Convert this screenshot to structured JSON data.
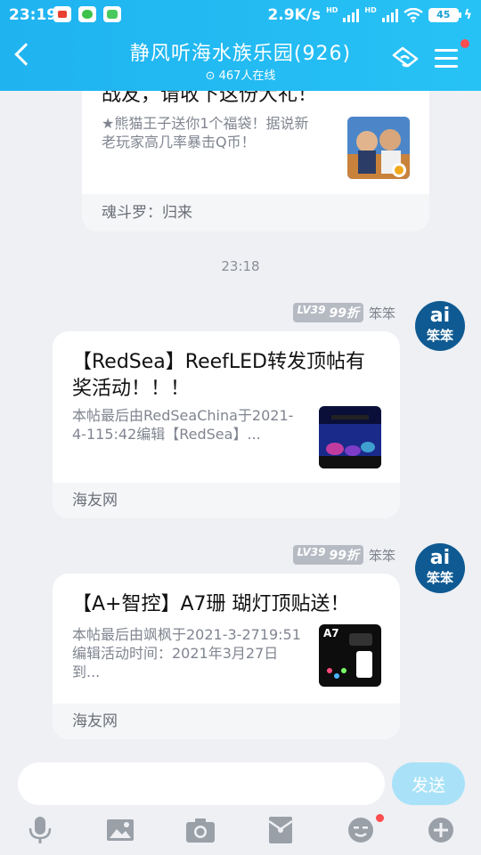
{
  "status_bar": {
    "time": "23:19",
    "net_speed": "2.9K/s",
    "hd1": "HD",
    "hd2": "HD",
    "battery": "45"
  },
  "header": {
    "title": "静风听海水族乐园(926)",
    "online": "467人在线"
  },
  "messages": [
    {
      "headline": "战友，请收下这份大礼！",
      "desc": "★熊猫王子送你1个福袋！据说新老玩家高几率暴击Q币！",
      "footer": "魂斗罗：归来"
    },
    {
      "timestamp": "23:18"
    },
    {
      "sender": "笨笨",
      "level": "LV39",
      "badge": "99折",
      "avatar_line1": "ai",
      "avatar_line2": "笨笨",
      "headline": "【RedSea】ReefLED转发顶帖有奖活动！！！",
      "desc": "本帖最后由RedSeaChina于2021-4-115:42编辑【RedSea】...",
      "footer": "海友网"
    },
    {
      "sender": "笨笨",
      "level": "LV39",
      "badge": "99折",
      "avatar_line1": "ai",
      "avatar_line2": "笨笨",
      "headline": "【A+智控】A7珊 瑚灯顶贴送！",
      "desc": "本帖最后由飒枫于2021-3-2719:51编辑活动时间：2021年3月27日到...",
      "thumb_label": "A7",
      "footer": "海友网"
    }
  ],
  "input_bar": {
    "placeholder": "",
    "send_label": "发送"
  },
  "colors": {
    "header": "#27c2f5",
    "accent": "#1fb3f0",
    "notify_dot": "#ff4d4f"
  }
}
